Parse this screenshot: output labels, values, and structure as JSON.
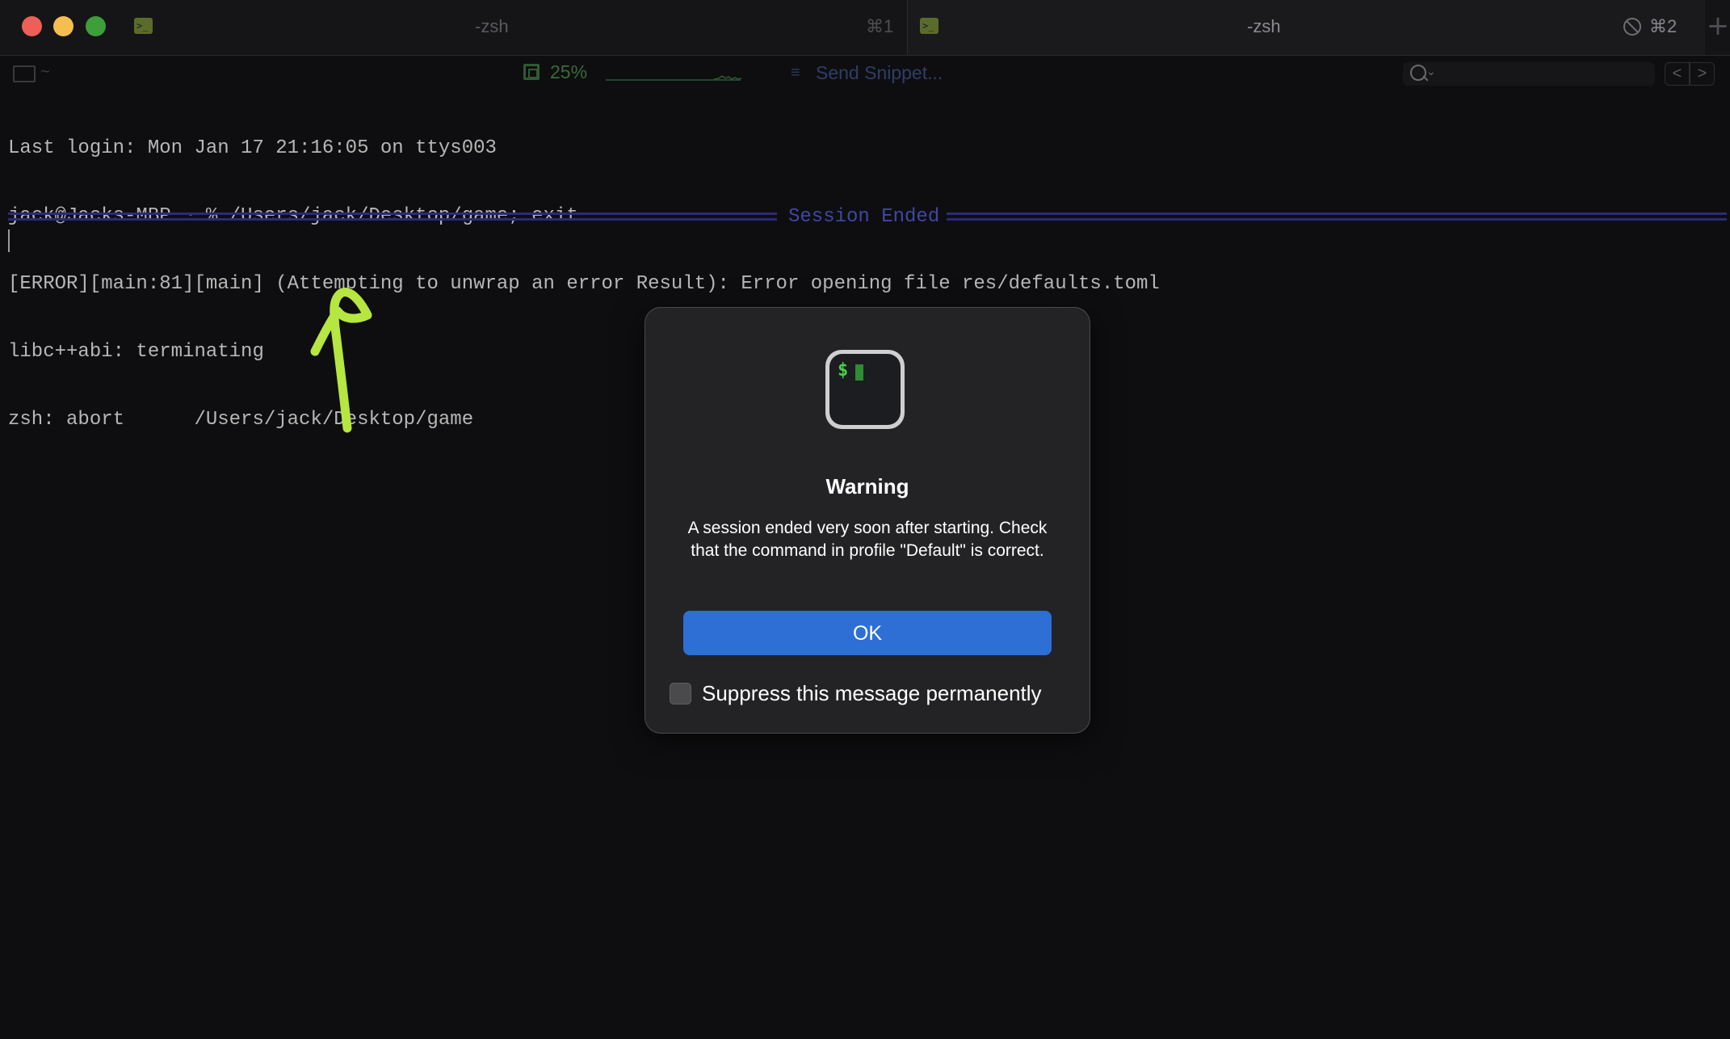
{
  "window": {
    "tabs": [
      {
        "title": "-zsh",
        "shortcut": "⌘1"
      },
      {
        "title": "-zsh",
        "shortcut": "⌘2"
      }
    ],
    "new_tab": "+"
  },
  "statusbar": {
    "folder": "~",
    "cpu": "25%",
    "snippet_icon": "≡",
    "snippet": "Send Snippet...",
    "search_placeholder": "",
    "prev": "<",
    "next": ">"
  },
  "terminal": {
    "lines": [
      "Last login: Mon Jan 17 21:16:05 on ttys003",
      "jack@Jacks-MBP ~ % /Users/jack/Desktop/game; exit",
      "[ERROR][main:81][main] (Attempting to unwrap an error Result): Error opening file res/defaults.toml",
      "libc++abi: terminating",
      "zsh: abort      /Users/jack/Desktop/game"
    ],
    "session_ended": "Session Ended"
  },
  "dialog": {
    "icon_prompt": "$",
    "title": "Warning",
    "message": "A session ended very soon after starting. Check that the command in profile \"Default\" is correct.",
    "ok": "OK",
    "suppress": "Suppress this message permanently"
  },
  "colors": {
    "annotation": "#b6e640",
    "ok_button": "#2d6fd4",
    "session_rule": "#2a2a7a"
  }
}
